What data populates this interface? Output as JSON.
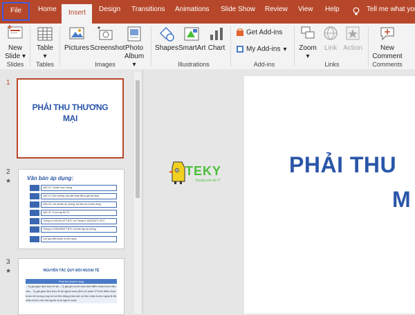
{
  "tabs": {
    "file": "File",
    "home": "Home",
    "insert": "Insert",
    "design": "Design",
    "transitions": "Transitions",
    "animations": "Animations",
    "slideshow": "Slide Show",
    "review": "Review",
    "view": "View",
    "help": "Help",
    "tellme": "Tell me what you"
  },
  "ribbon": {
    "new_slide": [
      "New",
      "Slide ▾"
    ],
    "table": [
      "Table",
      "▾"
    ],
    "pictures": "Pictures",
    "screenshot": "Screenshot",
    "photo_album": [
      "Photo",
      "Album ▾"
    ],
    "shapes": "Shapes",
    "smartart": "SmartArt",
    "chart": "Chart",
    "get_addins": "Get Add-ins",
    "my_addins": "My Add-ins",
    "zoom": "Zoom",
    "link": "Link",
    "action": "Action",
    "new_comment": [
      "New",
      "Comment"
    ],
    "groups": {
      "slides": "Slides",
      "tables": "Tables",
      "images": "Images",
      "illustrations": "Illustrations",
      "addins": "Add-ins",
      "links": "Links",
      "comments": "Comments"
    }
  },
  "thumbnails": {
    "n1": "1",
    "n2": "2",
    "n3": "3",
    "star": "★",
    "s1_title_a": "PHẢI THU THƯƠNG",
    "s1_title_b": "MẠI",
    "s2_title": "Văn bản áp dụng:",
    "s2_items": [
      "VAS 01: Chuẩn mực chung",
      "VAS 10: Ảnh hưởng của việc thay đổi tỷ giá hối đoái",
      "VAS 18: Các khoản dự phòng, tài sản và nợ tiềm tàng",
      "VAS 21: Trình bày BCTC",
      "Thông tư 200/2014/TT-BTC và Thông tư 53/2016/TT-BTC",
      "Thông tư 228/2009/TT-BTC và trích lập dự phòng",
      "Các quy định khác có liên quan"
    ],
    "s3_title": "NGUYÊN TẮC QUY ĐỔI NGOẠI TỆ",
    "s3_bar": "Phải thu khách hàng",
    "s3_text": "– Tỷ giá giao dịch thực tế tại – Tỷ giá ghi số kế toán thời điểm nhận trước tiền của – Tỷ giá giao dịch thực tế tại người mua (Đối với phần DT thời điểm nhận trước khi tương ứng với số tiền bằng phần ánh số tiền nhận trước ngoại tệ đã nhận trước của của người mua người mua)"
  },
  "main_slide": {
    "title_line1": "PHẢI THU",
    "title_line2": "M",
    "logo_text": "TEKY",
    "logo_sub": "Young can do IT"
  },
  "colors": {
    "accent": "#b7472a",
    "title_blue": "#2a56a8",
    "logo_green": "#4bbf3a"
  }
}
